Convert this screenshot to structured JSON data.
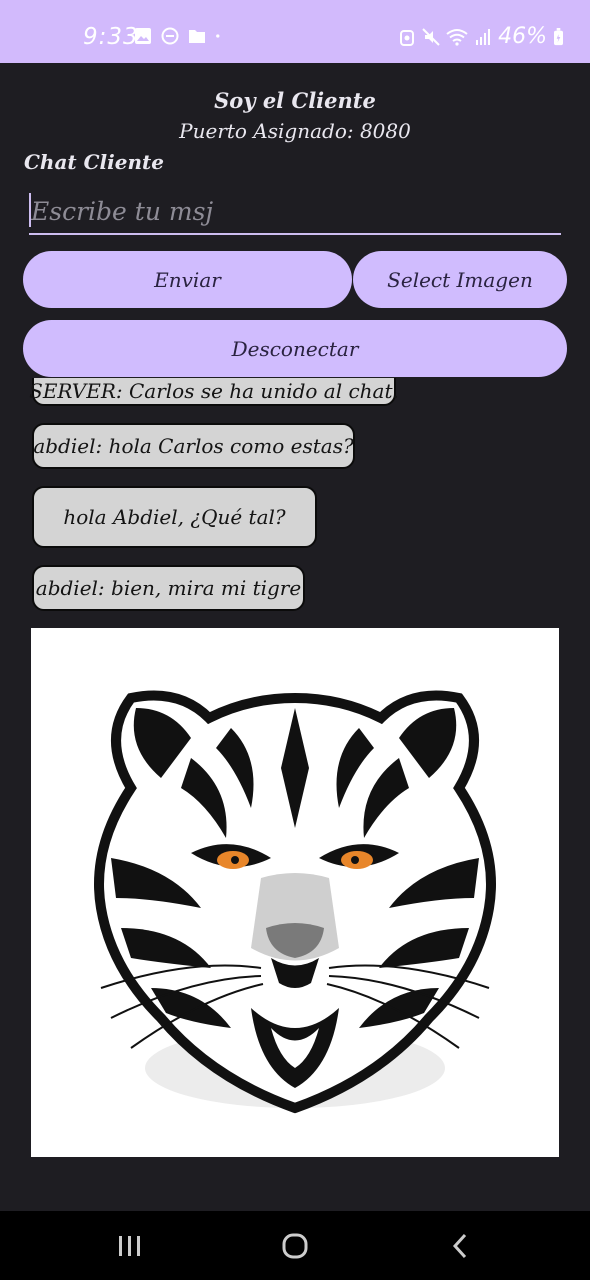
{
  "status_bar": {
    "time": "9:33",
    "battery": "46%",
    "left_icons": [
      "image-icon",
      "dnd-icon",
      "folder-icon",
      "dot-icon"
    ],
    "right_icons": [
      "alarm-icon",
      "mute-icon",
      "wifi-icon",
      "signal-icon",
      "battery-icon"
    ]
  },
  "header": {
    "title": "Soy el Cliente",
    "port": "Puerto Asignado: 8080"
  },
  "chat_label": "Chat Cliente",
  "input": {
    "placeholder": "Escribe tu msj",
    "value": ""
  },
  "buttons": {
    "send": "Enviar",
    "select_image": "Select Imagen",
    "disconnect": "Desconectar"
  },
  "messages": [
    {
      "text": "SERVER: Carlos se ha unido al chat."
    },
    {
      "text": "abdiel: hola Carlos como estas?"
    },
    {
      "text": "hola Abdiel, ¿Qué tal?"
    },
    {
      "text": "abdiel: bien, mira mi tigre"
    }
  ],
  "image_message": {
    "icon": "tiger-image"
  },
  "colors": {
    "accent": "#d0bcfe",
    "background": "#1e1d22",
    "bubble": "#d4d4d4",
    "nav_bar": "#000000"
  },
  "nav_bar": [
    "recents-icon",
    "home-icon",
    "back-icon"
  ]
}
